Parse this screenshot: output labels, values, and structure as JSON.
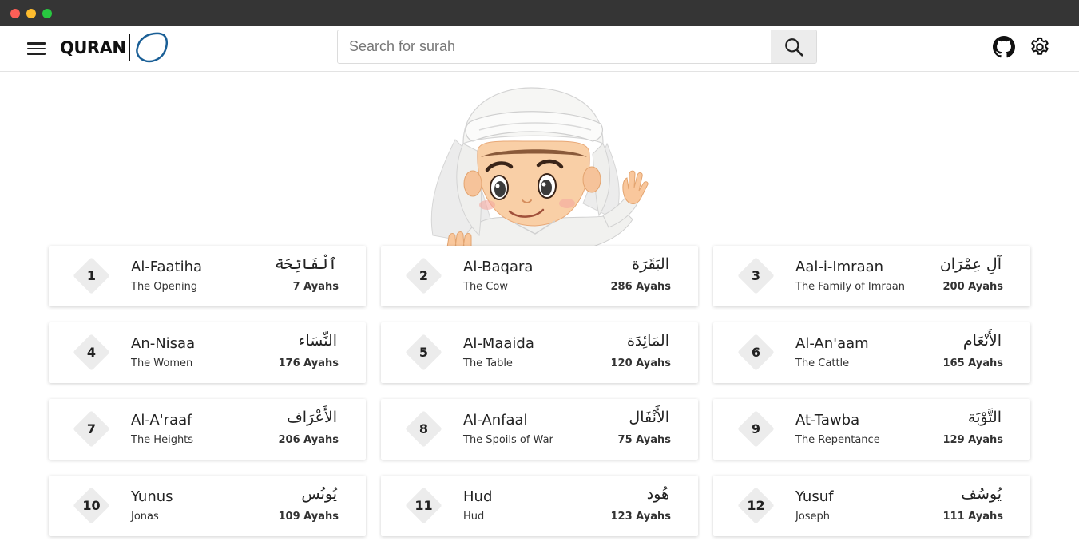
{
  "window": {
    "controls": [
      "close",
      "minimize",
      "maximize"
    ]
  },
  "header": {
    "logo_text": "QURAN",
    "search_placeholder": "Search for surah",
    "icons": [
      "menu-icon",
      "search-icon",
      "github-icon",
      "gear-icon"
    ]
  },
  "surahs": [
    {
      "number": "1",
      "name": "Al-Faatiha",
      "translation": "The Opening",
      "arabic": "ٱلْفَاتِحَة",
      "ayahs": "7 Ayahs"
    },
    {
      "number": "2",
      "name": "Al-Baqara",
      "translation": "The Cow",
      "arabic": "البَقَرَة",
      "ayahs": "286 Ayahs"
    },
    {
      "number": "3",
      "name": "Aal-i-Imraan",
      "translation": "The Family of Imraan",
      "arabic": "آلِ عِمْرَان",
      "ayahs": "200 Ayahs"
    },
    {
      "number": "4",
      "name": "An-Nisaa",
      "translation": "The Women",
      "arabic": "النِّسَاء",
      "ayahs": "176 Ayahs"
    },
    {
      "number": "5",
      "name": "Al-Maaida",
      "translation": "The Table",
      "arabic": "المَائِدَة",
      "ayahs": "120 Ayahs"
    },
    {
      "number": "6",
      "name": "Al-An'aam",
      "translation": "The Cattle",
      "arabic": "الأَنْعَام",
      "ayahs": "165 Ayahs"
    },
    {
      "number": "7",
      "name": "Al-A'raaf",
      "translation": "The Heights",
      "arabic": "الأَعْرَاف",
      "ayahs": "206 Ayahs"
    },
    {
      "number": "8",
      "name": "Al-Anfaal",
      "translation": "The Spoils of War",
      "arabic": "الأَنْفَال",
      "ayahs": "75 Ayahs"
    },
    {
      "number": "9",
      "name": "At-Tawba",
      "translation": "The Repentance",
      "arabic": "التَّوْبَة",
      "ayahs": "129 Ayahs"
    },
    {
      "number": "10",
      "name": "Yunus",
      "translation": "Jonas",
      "arabic": "يُونُس",
      "ayahs": "109 Ayahs"
    },
    {
      "number": "11",
      "name": "Hud",
      "translation": "Hud",
      "arabic": "هُود",
      "ayahs": "123 Ayahs"
    },
    {
      "number": "12",
      "name": "Yusuf",
      "translation": "Joseph",
      "arabic": "يُوسُف",
      "ayahs": "111 Ayahs"
    }
  ],
  "colors": {
    "accent": "#1a5f96",
    "titlebar": "#353535",
    "card_bg": "#ffffff",
    "diamond": "#ececec"
  }
}
